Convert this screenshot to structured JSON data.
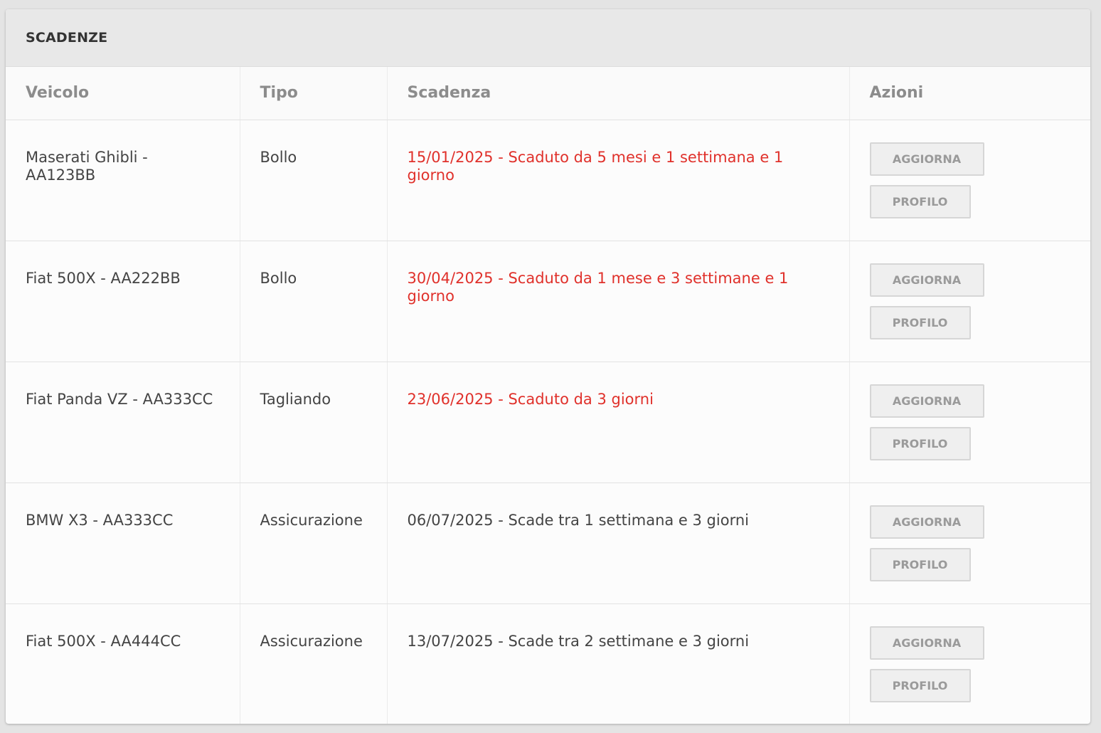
{
  "panel": {
    "title": "SCADENZE"
  },
  "table": {
    "headers": {
      "vehicle": "Veicolo",
      "type": "Tipo",
      "deadline": "Scadenza",
      "actions": "Azioni"
    },
    "rows": [
      {
        "vehicle": "Maserati Ghibli - AA123BB",
        "type": "Bollo",
        "deadline": "15/01/2025 - Scaduto da 5 mesi e 1 settimana e 1 giorno",
        "status": "expired",
        "update_label": "AGGIORNA",
        "profile_label": "PROFILO"
      },
      {
        "vehicle": "Fiat 500X - AA222BB",
        "type": "Bollo",
        "deadline": "30/04/2025 - Scaduto da 1 mese e 3 settimane e 1 giorno",
        "status": "expired",
        "update_label": "AGGIORNA",
        "profile_label": "PROFILO"
      },
      {
        "vehicle": "Fiat Panda VZ - AA333CC",
        "type": "Tagliando",
        "deadline": "23/06/2025 - Scaduto da 3 giorni",
        "status": "expired",
        "update_label": "AGGIORNA",
        "profile_label": "PROFILO"
      },
      {
        "vehicle": "BMW X3 - AA333CC",
        "type": "Assicurazione",
        "deadline": "06/07/2025 - Scade tra 1 settimana e 3 giorni",
        "status": "upcoming",
        "update_label": "AGGIORNA",
        "profile_label": "PROFILO"
      },
      {
        "vehicle": "Fiat 500X - AA444CC",
        "type": "Assicurazione",
        "deadline": "13/07/2025 - Scade tra 2 settimane e 3 giorni",
        "status": "upcoming",
        "update_label": "AGGIORNA",
        "profile_label": "PROFILO"
      }
    ]
  },
  "colors": {
    "expired": "#e0312b",
    "normal_text": "#444444",
    "header_text": "#8c8c8c"
  }
}
